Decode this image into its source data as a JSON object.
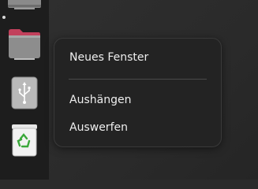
{
  "dock": {
    "items": [
      {
        "name": "folder-icon",
        "label": ""
      },
      {
        "name": "folder-icon",
        "label": ""
      },
      {
        "name": "usb-drive-icon",
        "label": ""
      },
      {
        "name": "trash-icon",
        "label": ""
      }
    ]
  },
  "context_menu": {
    "items": [
      {
        "label": "Neues Fenster"
      },
      {
        "label": "Aushängen"
      },
      {
        "label": "Auswerfen"
      }
    ]
  },
  "colors": {
    "menu_bg": "#232323",
    "dock_bg": "#1d1d1d",
    "folder_tab_accent": "#c2415c",
    "trash_accent": "#3aa83a"
  }
}
